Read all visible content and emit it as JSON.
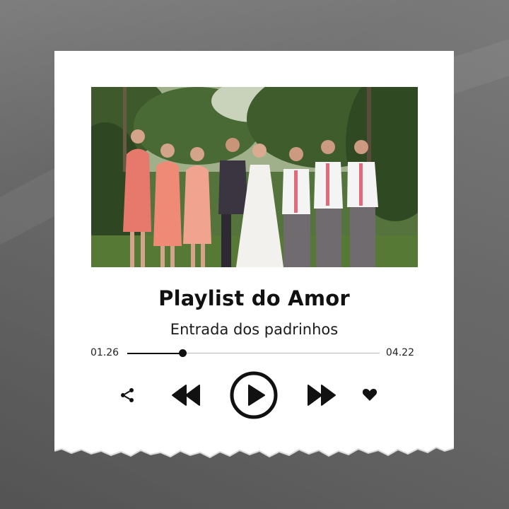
{
  "player": {
    "title": "Playlist do Amor",
    "subtitle": "Entrada dos padrinhos",
    "time_elapsed": "01.26",
    "time_total": "04.22",
    "progress_fraction": 0.22,
    "accent_color": "#111111"
  },
  "cover": {
    "icon": "wedding-party-photo"
  },
  "controls": {
    "share_icon": "share-icon",
    "rewind_icon": "rewind-icon",
    "play_icon": "play-icon",
    "forward_icon": "fast-forward-icon",
    "like_icon": "heart-icon"
  }
}
